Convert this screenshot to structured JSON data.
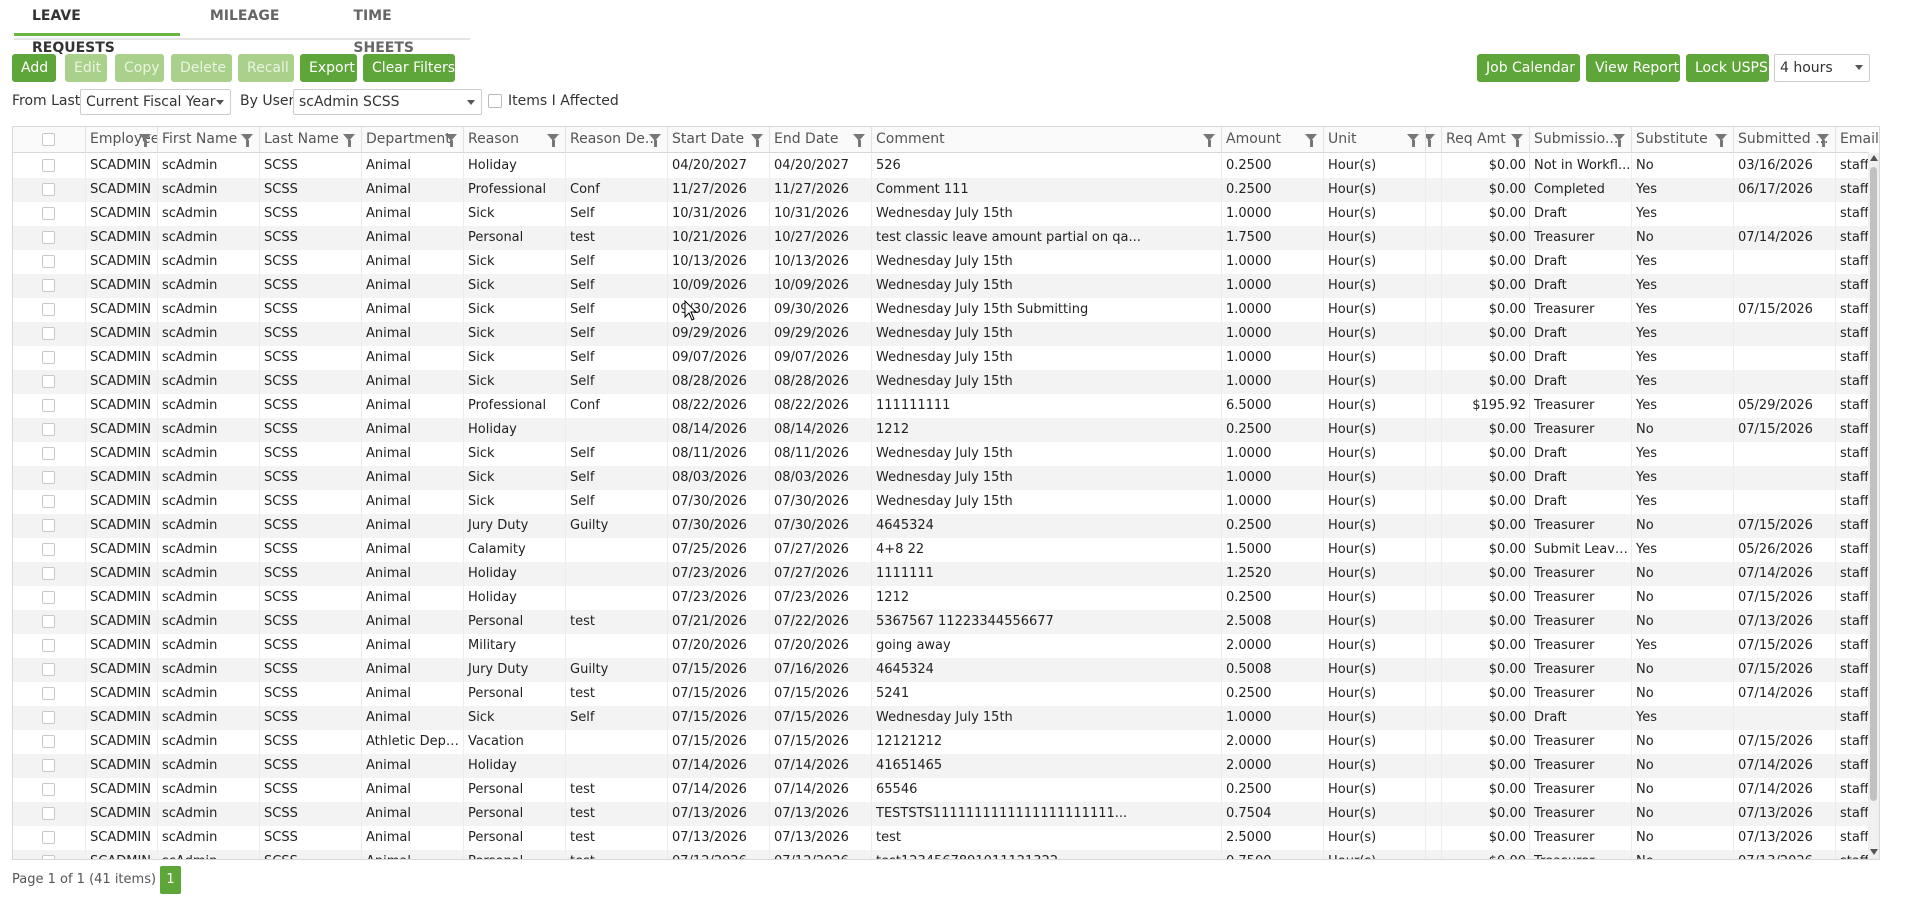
{
  "tabs": [
    {
      "label": "LEAVE REQUESTS",
      "active": true
    },
    {
      "label": "MILEAGE",
      "active": false
    },
    {
      "label": "TIME SHEETS",
      "active": false
    }
  ],
  "toolbar": {
    "add": "Add",
    "edit": "Edit",
    "copy": "Copy",
    "delete": "Delete",
    "recall": "Recall",
    "export": "Export",
    "clear_filters": "Clear Filters",
    "job_calendar": "Job Calendar",
    "view_report": "View Report",
    "lock_usps": "Lock USPS",
    "hours_select": "4 hours"
  },
  "filters": {
    "from_last_label": "From Last",
    "from_last_value": "Current Fiscal Year",
    "by_user_label": "By User",
    "by_user_value": "scAdmin SCSS",
    "items_affected_label": "Items I Affected"
  },
  "columns": [
    "Employee ID",
    "First Name",
    "Last Name",
    "Department",
    "Reason",
    "Reason De...",
    "Start Date",
    "End Date",
    "Comment",
    "Amount",
    "Unit",
    "",
    "Req Amt",
    "Submissio...",
    "Substitute",
    "Submitted ...",
    "Email"
  ],
  "rows": [
    [
      "SCADMIN",
      "scAdmin",
      "SCSS",
      "Animal",
      "Holiday",
      "",
      "04/20/2027",
      "04/20/2027",
      "526",
      "0.2500",
      "Hour(s)",
      "",
      "$0.00",
      "Not in Workfl...",
      "No",
      "03/16/2026",
      "staff@scview...."
    ],
    [
      "SCADMIN",
      "scAdmin",
      "SCSS",
      "Animal",
      "Professional",
      "Conf",
      "11/27/2026",
      "11/27/2026",
      "Comment 111",
      "0.2500",
      "Hour(s)",
      "",
      "$0.00",
      "Completed",
      "Yes",
      "06/17/2026",
      "staff@scview...."
    ],
    [
      "SCADMIN",
      "scAdmin",
      "SCSS",
      "Animal",
      "Sick",
      "Self",
      "10/31/2026",
      "10/31/2026",
      "Wednesday July 15th",
      "1.0000",
      "Hour(s)",
      "",
      "$0.00",
      "Draft",
      "Yes",
      "",
      "staff@scview...."
    ],
    [
      "SCADMIN",
      "scAdmin",
      "SCSS",
      "Animal",
      "Personal",
      "test",
      "10/21/2026",
      "10/27/2026",
      "test classic leave amount partial on qa...",
      "1.7500",
      "Hour(s)",
      "",
      "$0.00",
      "Treasurer",
      "No",
      "07/14/2026",
      "staff@scview...."
    ],
    [
      "SCADMIN",
      "scAdmin",
      "SCSS",
      "Animal",
      "Sick",
      "Self",
      "10/13/2026",
      "10/13/2026",
      "Wednesday July 15th",
      "1.0000",
      "Hour(s)",
      "",
      "$0.00",
      "Draft",
      "Yes",
      "",
      "staff@scview...."
    ],
    [
      "SCADMIN",
      "scAdmin",
      "SCSS",
      "Animal",
      "Sick",
      "Self",
      "10/09/2026",
      "10/09/2026",
      "Wednesday July 15th",
      "1.0000",
      "Hour(s)",
      "",
      "$0.00",
      "Draft",
      "Yes",
      "",
      "staff@scview...."
    ],
    [
      "SCADMIN",
      "scAdmin",
      "SCSS",
      "Animal",
      "Sick",
      "Self",
      "09/30/2026",
      "09/30/2026",
      "Wednesday July 15th Submitting",
      "1.0000",
      "Hour(s)",
      "",
      "$0.00",
      "Treasurer",
      "Yes",
      "07/15/2026",
      "staff@scview...."
    ],
    [
      "SCADMIN",
      "scAdmin",
      "SCSS",
      "Animal",
      "Sick",
      "Self",
      "09/29/2026",
      "09/29/2026",
      "Wednesday July 15th",
      "1.0000",
      "Hour(s)",
      "",
      "$0.00",
      "Draft",
      "Yes",
      "",
      "staff@scview...."
    ],
    [
      "SCADMIN",
      "scAdmin",
      "SCSS",
      "Animal",
      "Sick",
      "Self",
      "09/07/2026",
      "09/07/2026",
      "Wednesday July 15th",
      "1.0000",
      "Hour(s)",
      "",
      "$0.00",
      "Draft",
      "Yes",
      "",
      "staff@scview...."
    ],
    [
      "SCADMIN",
      "scAdmin",
      "SCSS",
      "Animal",
      "Sick",
      "Self",
      "08/28/2026",
      "08/28/2026",
      "Wednesday July 15th",
      "1.0000",
      "Hour(s)",
      "",
      "$0.00",
      "Draft",
      "Yes",
      "",
      "staff@scview...."
    ],
    [
      "SCADMIN",
      "scAdmin",
      "SCSS",
      "Animal",
      "Professional",
      "Conf",
      "08/22/2026",
      "08/22/2026",
      "111111111",
      "6.5000",
      "Hour(s)",
      "",
      "$195.92",
      "Treasurer",
      "Yes",
      "05/29/2026",
      "staff@scview...."
    ],
    [
      "SCADMIN",
      "scAdmin",
      "SCSS",
      "Animal",
      "Holiday",
      "",
      "08/14/2026",
      "08/14/2026",
      "1212",
      "0.2500",
      "Hour(s)",
      "",
      "$0.00",
      "Treasurer",
      "No",
      "07/15/2026",
      "staff@scview...."
    ],
    [
      "SCADMIN",
      "scAdmin",
      "SCSS",
      "Animal",
      "Sick",
      "Self",
      "08/11/2026",
      "08/11/2026",
      "Wednesday July 15th",
      "1.0000",
      "Hour(s)",
      "",
      "$0.00",
      "Draft",
      "Yes",
      "",
      "staff@scview...."
    ],
    [
      "SCADMIN",
      "scAdmin",
      "SCSS",
      "Animal",
      "Sick",
      "Self",
      "08/03/2026",
      "08/03/2026",
      "Wednesday July 15th",
      "1.0000",
      "Hour(s)",
      "",
      "$0.00",
      "Draft",
      "Yes",
      "",
      "staff@scview...."
    ],
    [
      "SCADMIN",
      "scAdmin",
      "SCSS",
      "Animal",
      "Sick",
      "Self",
      "07/30/2026",
      "07/30/2026",
      "Wednesday July 15th",
      "1.0000",
      "Hour(s)",
      "",
      "$0.00",
      "Draft",
      "Yes",
      "",
      "staff@scview...."
    ],
    [
      "SCADMIN",
      "scAdmin",
      "SCSS",
      "Animal",
      "Jury Duty",
      "Guilty",
      "07/30/2026",
      "07/30/2026",
      "4645324",
      "0.2500",
      "Hour(s)",
      "",
      "$0.00",
      "Treasurer",
      "No",
      "07/15/2026",
      "staff@scview...."
    ],
    [
      "SCADMIN",
      "scAdmin",
      "SCSS",
      "Animal",
      "Calamity",
      "",
      "07/25/2026",
      "07/27/2026",
      "4+8 22",
      "1.5000",
      "Hour(s)",
      "",
      "$0.00",
      "Submit Leave ...",
      "Yes",
      "05/26/2026",
      "staff@scview...."
    ],
    [
      "SCADMIN",
      "scAdmin",
      "SCSS",
      "Animal",
      "Holiday",
      "",
      "07/23/2026",
      "07/27/2026",
      "1111111",
      "1.2520",
      "Hour(s)",
      "",
      "$0.00",
      "Treasurer",
      "No",
      "07/14/2026",
      "staff@scview...."
    ],
    [
      "SCADMIN",
      "scAdmin",
      "SCSS",
      "Animal",
      "Holiday",
      "",
      "07/23/2026",
      "07/23/2026",
      "1212",
      "0.2500",
      "Hour(s)",
      "",
      "$0.00",
      "Treasurer",
      "No",
      "07/15/2026",
      "staff@scview...."
    ],
    [
      "SCADMIN",
      "scAdmin",
      "SCSS",
      "Animal",
      "Personal",
      "test",
      "07/21/2026",
      "07/22/2026",
      "5367567 11223344556677",
      "2.5008",
      "Hour(s)",
      "",
      "$0.00",
      "Treasurer",
      "No",
      "07/13/2026",
      "staff@scview...."
    ],
    [
      "SCADMIN",
      "scAdmin",
      "SCSS",
      "Animal",
      "Military",
      "",
      "07/20/2026",
      "07/20/2026",
      "going away",
      "2.0000",
      "Hour(s)",
      "",
      "$0.00",
      "Treasurer",
      "Yes",
      "07/15/2026",
      "staff@scview...."
    ],
    [
      "SCADMIN",
      "scAdmin",
      "SCSS",
      "Animal",
      "Jury Duty",
      "Guilty",
      "07/15/2026",
      "07/16/2026",
      "4645324",
      "0.5008",
      "Hour(s)",
      "",
      "$0.00",
      "Treasurer",
      "No",
      "07/15/2026",
      "staff@scview...."
    ],
    [
      "SCADMIN",
      "scAdmin",
      "SCSS",
      "Animal",
      "Personal",
      "test",
      "07/15/2026",
      "07/15/2026",
      "5241",
      "0.2500",
      "Hour(s)",
      "",
      "$0.00",
      "Treasurer",
      "No",
      "07/14/2026",
      "staff@scview...."
    ],
    [
      "SCADMIN",
      "scAdmin",
      "SCSS",
      "Animal",
      "Sick",
      "Self",
      "07/15/2026",
      "07/15/2026",
      "Wednesday July 15th",
      "1.0000",
      "Hour(s)",
      "",
      "$0.00",
      "Draft",
      "Yes",
      "",
      "staff@scview...."
    ],
    [
      "SCADMIN",
      "scAdmin",
      "SCSS",
      "Athletic Depa...",
      "Vacation",
      "",
      "07/15/2026",
      "07/15/2026",
      "12121212",
      "2.0000",
      "Hour(s)",
      "",
      "$0.00",
      "Treasurer",
      "No",
      "07/15/2026",
      "staff@scview...."
    ],
    [
      "SCADMIN",
      "scAdmin",
      "SCSS",
      "Animal",
      "Holiday",
      "",
      "07/14/2026",
      "07/14/2026",
      "41651465",
      "2.0000",
      "Hour(s)",
      "",
      "$0.00",
      "Treasurer",
      "No",
      "07/14/2026",
      "staff@scview...."
    ],
    [
      "SCADMIN",
      "scAdmin",
      "SCSS",
      "Animal",
      "Personal",
      "test",
      "07/14/2026",
      "07/14/2026",
      "65546",
      "0.2500",
      "Hour(s)",
      "",
      "$0.00",
      "Treasurer",
      "No",
      "07/14/2026",
      "staff@scview...."
    ],
    [
      "SCADMIN",
      "scAdmin",
      "SCSS",
      "Animal",
      "Personal",
      "test",
      "07/13/2026",
      "07/13/2026",
      "TESTSTS1111111111111111111111...",
      "0.7504",
      "Hour(s)",
      "",
      "$0.00",
      "Treasurer",
      "No",
      "07/13/2026",
      "staff@scview...."
    ],
    [
      "SCADMIN",
      "scAdmin",
      "SCSS",
      "Animal",
      "Personal",
      "test",
      "07/13/2026",
      "07/13/2026",
      "test",
      "2.5000",
      "Hour(s)",
      "",
      "$0.00",
      "Treasurer",
      "No",
      "07/13/2026",
      "staff@scview...."
    ],
    [
      "SCADMIN",
      "scAdmin",
      "SCSS",
      "Animal",
      "Personal",
      "test",
      "07/12/2026",
      "07/12/2026",
      "test1234567891011121322",
      "0.7500",
      "Hour(s)",
      "",
      "$0.00",
      "Treasurer",
      "No",
      "07/13/2026",
      "staff@scview...."
    ]
  ],
  "pager": {
    "summary": "Page 1 of 1 (41 items)",
    "current_page": "1"
  },
  "colors": {
    "accent": "#5fa63a",
    "accent_disabled": "#a9d18c",
    "tab_underline": "#6db33f"
  }
}
